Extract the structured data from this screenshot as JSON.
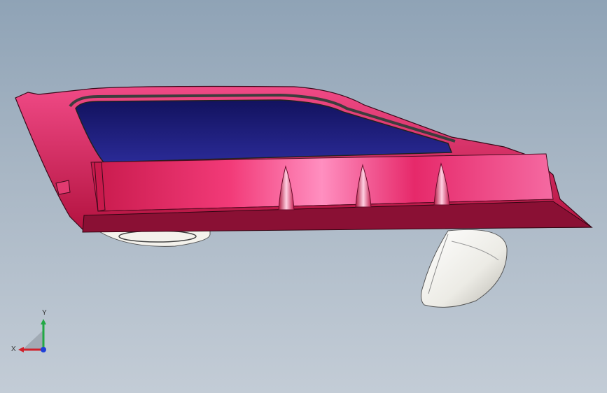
{
  "viewport": {
    "model": "door-assembly-model",
    "colors": {
      "background_top": "#8fa3b6",
      "background_bottom": "#c3ccd6",
      "door_panel": "#e0245e",
      "window_glass": "#1c1c7a",
      "mirror": "#f2f0ea"
    }
  },
  "triad": {
    "x_label": "X",
    "y_label": "Y",
    "colors": {
      "x": "#d0202a",
      "y": "#22a845",
      "z": "#1e3fd8"
    }
  }
}
